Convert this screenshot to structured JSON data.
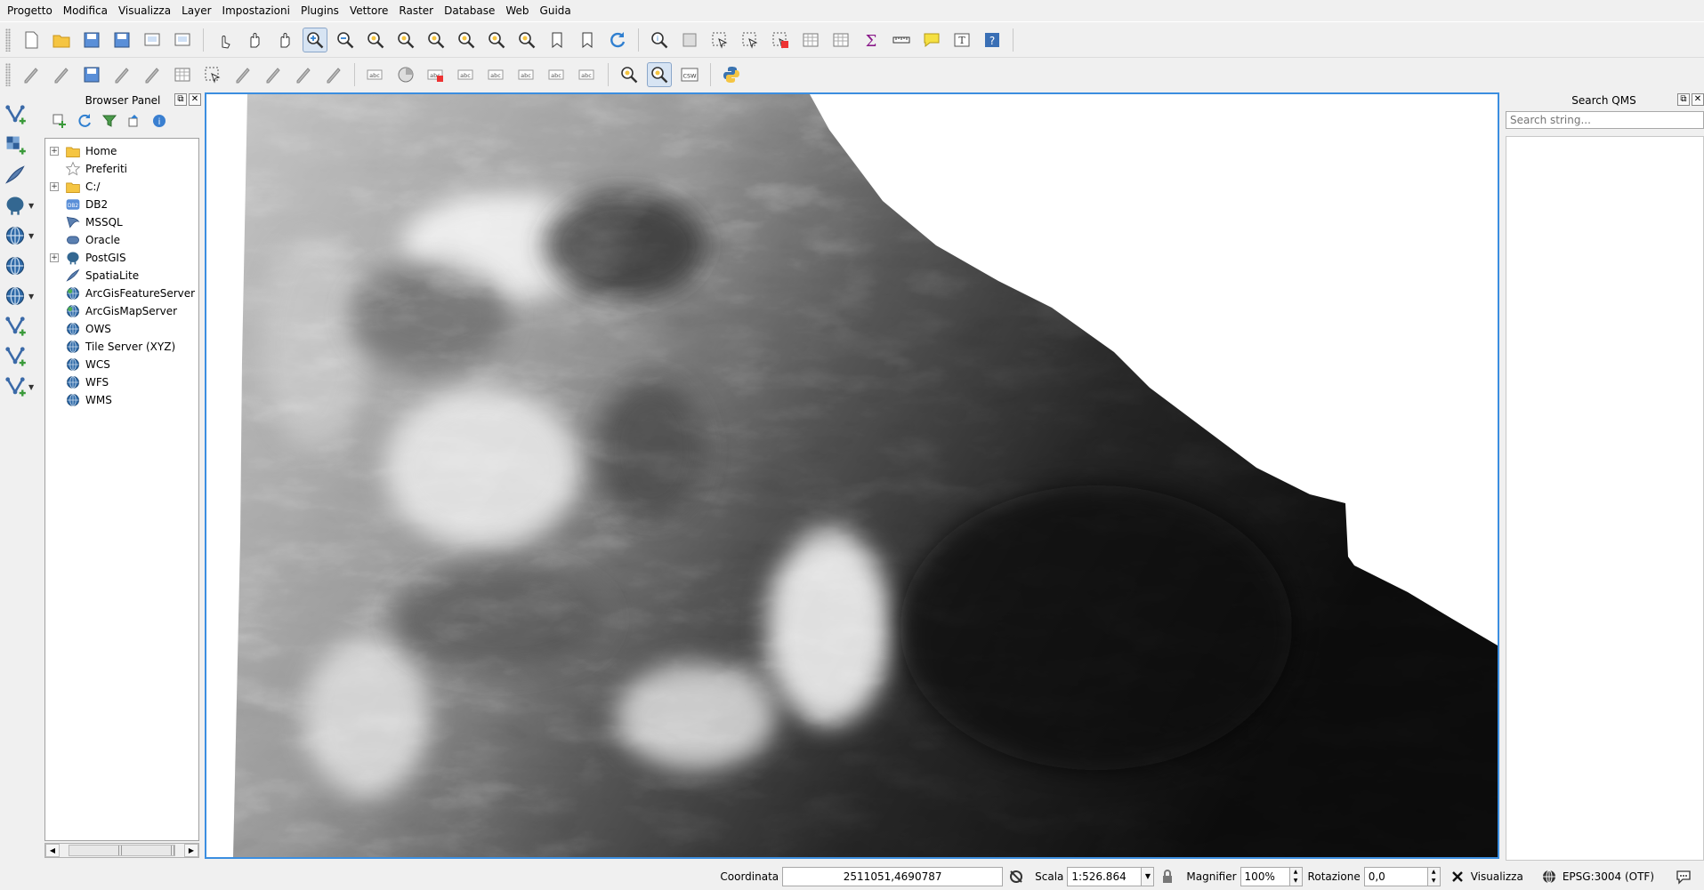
{
  "menu": [
    "Progetto",
    "Modifica",
    "Visualizza",
    "Layer",
    "Impostazioni",
    "Plugins",
    "Vettore",
    "Raster",
    "Database",
    "Web",
    "Guida"
  ],
  "toolbar1": [
    {
      "name": "new-project-icon"
    },
    {
      "name": "open-project-icon"
    },
    {
      "name": "save-project-icon"
    },
    {
      "name": "save-as-icon"
    },
    {
      "name": "new-print-layout-icon"
    },
    {
      "name": "layout-manager-icon"
    },
    {
      "name": "touch-zoom-icon"
    },
    {
      "name": "pan-icon"
    },
    {
      "name": "pan-to-selection-icon"
    },
    {
      "name": "zoom-in-icon",
      "active": true
    },
    {
      "name": "zoom-out-icon"
    },
    {
      "name": "zoom-native-icon"
    },
    {
      "name": "zoom-full-icon"
    },
    {
      "name": "zoom-to-selection-icon"
    },
    {
      "name": "zoom-to-layer-icon"
    },
    {
      "name": "zoom-last-icon"
    },
    {
      "name": "zoom-next-icon"
    },
    {
      "name": "new-bookmark-icon"
    },
    {
      "name": "show-bookmarks-icon"
    },
    {
      "name": "refresh-icon"
    },
    {
      "name": "identify-icon"
    },
    {
      "name": "run-action-icon"
    },
    {
      "name": "select-features-icon"
    },
    {
      "name": "select-by-expression-icon"
    },
    {
      "name": "deselect-icon"
    },
    {
      "name": "attribute-table-icon"
    },
    {
      "name": "field-calculator-icon"
    },
    {
      "name": "statistics-icon"
    },
    {
      "name": "measure-icon"
    },
    {
      "name": "map-tips-icon"
    },
    {
      "name": "text-annotation-icon"
    },
    {
      "name": "help-icon"
    }
  ],
  "toolbar2": [
    {
      "name": "current-edits-icon"
    },
    {
      "name": "toggle-editing-icon"
    },
    {
      "name": "save-edits-icon"
    },
    {
      "name": "add-feature-icon"
    },
    {
      "name": "vertex-tool-icon"
    },
    {
      "name": "add-record-icon"
    },
    {
      "name": "delete-selected-icon"
    },
    {
      "name": "delete-icon"
    },
    {
      "name": "cut-features-icon"
    },
    {
      "name": "copy-features-icon"
    },
    {
      "name": "paste-features-icon"
    },
    {
      "name": "label-abc-icon"
    },
    {
      "name": "diagram-icon"
    },
    {
      "name": "label-highlight-icon"
    },
    {
      "name": "pin-labels-icon"
    },
    {
      "name": "show-hide-labels-icon"
    },
    {
      "name": "move-label-icon"
    },
    {
      "name": "rotate-label-icon"
    },
    {
      "name": "change-label-icon"
    },
    {
      "name": "metasearch-icon"
    },
    {
      "name": "qms-search-icon",
      "active": true
    },
    {
      "name": "csw-icon",
      "text": "CSW"
    },
    {
      "name": "python-console-icon"
    }
  ],
  "left_toolbar": [
    {
      "name": "add-vector-layer-icon",
      "dropdown": false
    },
    {
      "name": "add-raster-layer-icon",
      "dropdown": false
    },
    {
      "name": "add-spatialite-layer-icon",
      "dropdown": false
    },
    {
      "name": "add-postgis-layer-icon",
      "dropdown": true
    },
    {
      "name": "add-wms-layer-icon",
      "dropdown": true
    },
    {
      "name": "add-wcs-layer-icon",
      "dropdown": false
    },
    {
      "name": "add-wfs-layer-icon",
      "dropdown": true
    },
    {
      "name": "add-virtual-layer-icon",
      "dropdown": false
    },
    {
      "name": "add-delimited-text-icon",
      "dropdown": false
    },
    {
      "name": "new-shapefile-icon",
      "dropdown": true
    }
  ],
  "browser": {
    "title": "Browser Panel",
    "items": [
      {
        "label": "Home",
        "icon": "folder-icon",
        "expandable": true
      },
      {
        "label": "Preferiti",
        "icon": "star-icon",
        "expandable": false
      },
      {
        "label": "C:/",
        "icon": "folder-icon",
        "expandable": true
      },
      {
        "label": "DB2",
        "icon": "db2-icon",
        "expandable": false
      },
      {
        "label": "MSSQL",
        "icon": "mssql-icon",
        "expandable": false
      },
      {
        "label": "Oracle",
        "icon": "oracle-icon",
        "expandable": false
      },
      {
        "label": "PostGIS",
        "icon": "postgis-icon",
        "expandable": true
      },
      {
        "label": "SpatiaLite",
        "icon": "spatialite-icon",
        "expandable": false
      },
      {
        "label": "ArcGisFeatureServer",
        "icon": "arcgis-feature-icon",
        "expandable": false
      },
      {
        "label": "ArcGisMapServer",
        "icon": "arcgis-map-icon",
        "expandable": false
      },
      {
        "label": "OWS",
        "icon": "ows-icon",
        "expandable": false
      },
      {
        "label": "Tile Server (XYZ)",
        "icon": "xyz-icon",
        "expandable": false
      },
      {
        "label": "WCS",
        "icon": "wcs-icon",
        "expandable": false
      },
      {
        "label": "WFS",
        "icon": "wfs-icon",
        "expandable": false
      },
      {
        "label": "WMS",
        "icon": "wms-icon",
        "expandable": false
      }
    ]
  },
  "qms": {
    "title": "Search QMS",
    "placeholder": "Search string..."
  },
  "status": {
    "coord_label": "Coordinata",
    "coord_value": "2511051,4690787",
    "scale_label": "Scala",
    "scale_value": "1:526.864",
    "magnifier_label": "Magnifier",
    "magnifier_value": "100%",
    "rotation_label": "Rotazione",
    "rotation_value": "0,0",
    "render_label": "Visualizza",
    "crs_label": "EPSG:3004 (OTF)"
  },
  "colors": {
    "accent": "#3b8ee0",
    "folder": "#f5c542",
    "globe": "#2f6aa8"
  }
}
